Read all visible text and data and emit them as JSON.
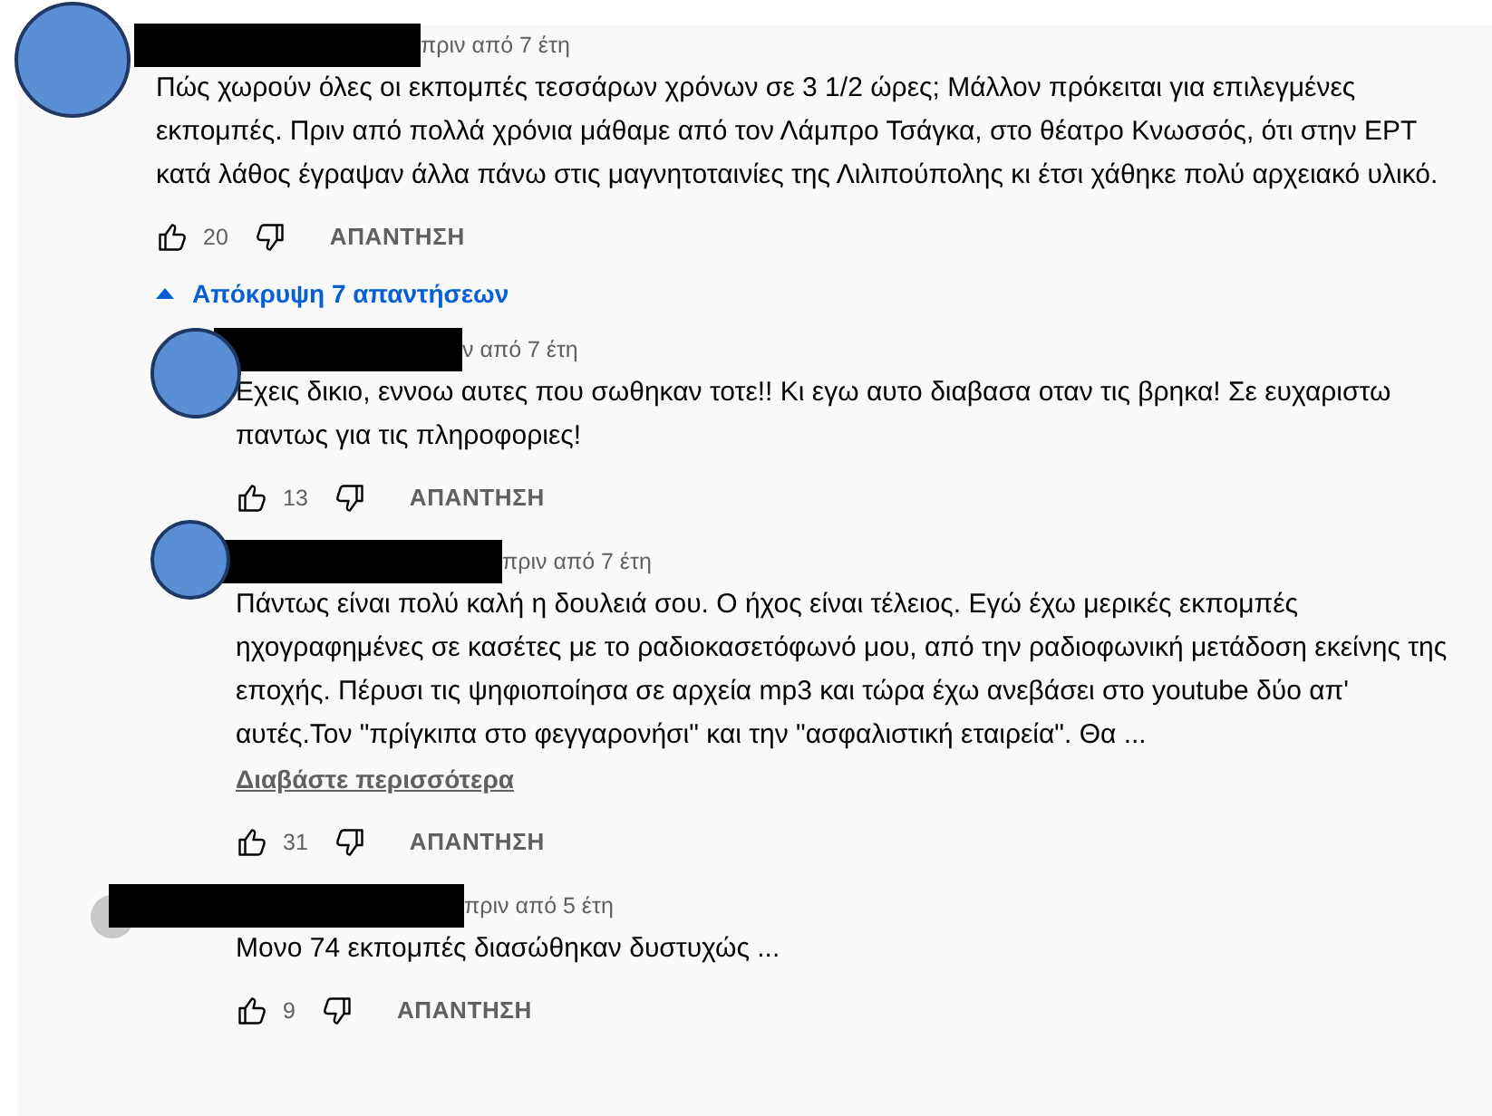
{
  "comments": [
    {
      "kind": "top",
      "avatar_covered": true,
      "author_redacted": true,
      "timestamp": "πριν από 7 έτη",
      "text": "Πώς χωρούν όλες οι εκπομπές τεσσάρων χρόνων σε 3 1/2 ώρες; Μάλλον πρόκειται για επιλεγμένες εκπομπές. Πριν από πολλά χρόνια μάθαμε από τον Λάμπρο Τσάγκα, στο θέατρο Κνωσσός, ότι στην ΕΡΤ κατά λάθος έγραψαν άλλα πάνω στις μαγνητοταινίες της Λιλιπούπολης κι έτσι χάθηκε πολύ αρχειακό υλικό.",
      "likes": "20",
      "reply_label": "ΑΠΑΝΤΗΣΗ",
      "replies_toggle": {
        "label": "Απόκρυψη 7 απαντήσεων",
        "expanded": true
      }
    },
    {
      "kind": "reply",
      "avatar_covered": true,
      "author_redacted": true,
      "timestamp": "ν από 7 έτη",
      "text": "Εχεις δικιο, εννοω αυτες που σωθηκαν τοτε!! Κι εγω αυτο διαβασα οταν τις βρηκα! Σε ευχαριστω παντως για τις πληροφοριες!",
      "likes": "13",
      "reply_label": "ΑΠΑΝΤΗΣΗ"
    },
    {
      "kind": "reply",
      "avatar_covered": true,
      "author_redacted": true,
      "timestamp": "πριν από 7 έτη",
      "text": "Πάντως είναι πολύ καλή η δουλειά σου. Ο ήχος είναι τέλειος. Εγώ έχω μερικές εκπομπές ηχογραφημένες σε κασέτες με το ραδιοκασετόφωνό μου, από την ραδιοφωνική μετάδοση εκείνης της εποχής. Πέρυσι τις ψηφιοποίησα σε αρχεία mp3 και τώρα έχω ανεβάσει στο youtube δύο απ' αυτές.Τον \"πρίγκιπα στο φεγγαρονήσι\" και την \"ασφαλιστική εταιρεία\". Θα ...",
      "read_more": "Διαβάστε περισσότερα",
      "likes": "31",
      "reply_label": "ΑΠΑΝΤΗΣΗ"
    },
    {
      "kind": "reply",
      "avatar_covered": false,
      "author_redacted": true,
      "timestamp": "πριν από 5 έτη",
      "text": "Μονο 74 εκπομπές διασώθηκαν δυστυχώς ...",
      "likes": "9",
      "reply_label": "ΑΠΑΝΤΗΣΗ"
    }
  ]
}
